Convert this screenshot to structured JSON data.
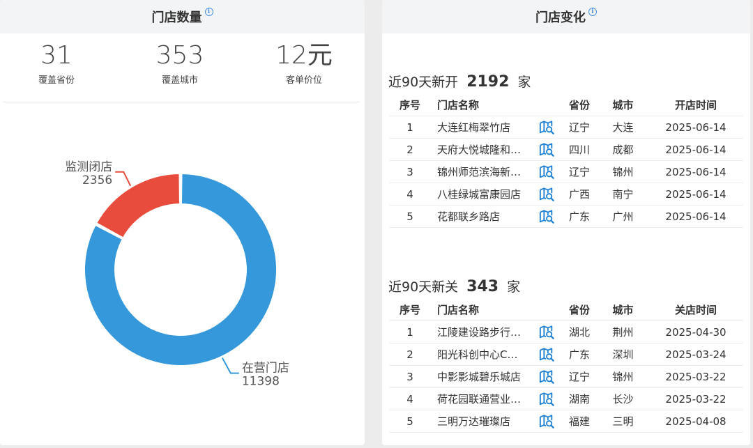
{
  "left_panel": {
    "title": "门店数量",
    "info_glyph": "i",
    "stats": [
      {
        "value": "31",
        "label": "覆盖省份"
      },
      {
        "value": "353",
        "label": "覆盖城市"
      },
      {
        "value": "12元",
        "label": "客单价位"
      }
    ]
  },
  "chart_data": {
    "type": "pie",
    "variant": "donut",
    "slices": [
      {
        "name": "在营门店",
        "value": 11398,
        "value_label": "11398",
        "color": "#3498db"
      },
      {
        "name": "监测闭店",
        "value": 2356,
        "value_label": "2356",
        "color": "#e74c3c"
      }
    ]
  },
  "right_panel": {
    "title": "门店变化",
    "info_glyph": "i",
    "map_icon_name": "map-search-icon",
    "accent_color": "#1a7fd1",
    "opened": {
      "prefix": "近90天新开",
      "count": "2192",
      "suffix": "家",
      "headers": [
        "序号",
        "门店名称",
        "省份",
        "城市",
        "开店时间"
      ],
      "rows": [
        {
          "idx": "1",
          "name": "大连红梅翠竹店",
          "prov": "辽宁",
          "city": "大连",
          "date": "2025-06-14"
        },
        {
          "idx": "2",
          "name": "天府大悦城隆和…",
          "prov": "四川",
          "city": "成都",
          "date": "2025-06-14"
        },
        {
          "idx": "3",
          "name": "锦州师范滨海新…",
          "prov": "辽宁",
          "city": "锦州",
          "date": "2025-06-14"
        },
        {
          "idx": "4",
          "name": "八桂绿城富康园店",
          "prov": "广西",
          "city": "南宁",
          "date": "2025-06-14"
        },
        {
          "idx": "5",
          "name": "花都联乡路店",
          "prov": "广东",
          "city": "广州",
          "date": "2025-06-14"
        }
      ]
    },
    "closed": {
      "prefix": "近90天新关",
      "count": "343",
      "suffix": "家",
      "headers": [
        "序号",
        "门店名称",
        "省份",
        "城市",
        "关店时间"
      ],
      "rows": [
        {
          "idx": "1",
          "name": "江陵建设路步行…",
          "prov": "湖北",
          "city": "荆州",
          "date": "2025-04-30"
        },
        {
          "idx": "2",
          "name": "阳光科创中心C…",
          "prov": "广东",
          "city": "深圳",
          "date": "2025-03-24"
        },
        {
          "idx": "3",
          "name": "中影影城碧乐城店",
          "prov": "辽宁",
          "city": "锦州",
          "date": "2025-03-22"
        },
        {
          "idx": "4",
          "name": "荷花园联通营业…",
          "prov": "湖南",
          "city": "长沙",
          "date": "2025-03-22"
        },
        {
          "idx": "5",
          "name": "三明万达璀璨店",
          "prov": "福建",
          "city": "三明",
          "date": "2025-04-08"
        }
      ]
    }
  }
}
